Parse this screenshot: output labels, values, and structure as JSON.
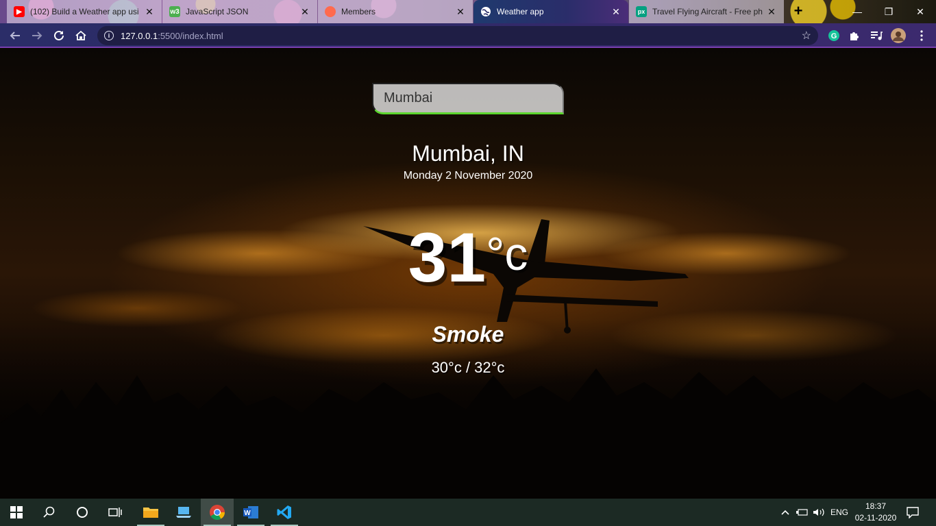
{
  "browser": {
    "tabs": [
      {
        "title": "(102) Build a Weather app usi",
        "favicon": "youtube-icon",
        "color": "#ff0000",
        "active": false
      },
      {
        "title": "JavaScript JSON",
        "favicon": "w3schools-icon",
        "color": "#4caf50",
        "active": false
      },
      {
        "title": "Members",
        "favicon": "members-icon",
        "color": "#ff6a4d",
        "active": false
      },
      {
        "title": "Weather app",
        "favicon": "globe-icon",
        "color": "#ffffff",
        "active": true
      },
      {
        "title": "Travel Flying Aircraft - Free ph",
        "favicon": "pexels-icon",
        "color": "#05a081",
        "active": false
      }
    ],
    "url_host": "127.0.0.1",
    "url_rest": ":5500/index.html"
  },
  "weather": {
    "search_value": "Mumbai",
    "location": "Mumbai, IN",
    "date": "Monday 2 November 2020",
    "temp": "31",
    "temp_unit": "°c",
    "condition": "Smoke",
    "hi_low": "30°c / 32°c"
  },
  "taskbar": {
    "language": "ENG",
    "time": "18:37",
    "date": "02-11-2020"
  },
  "colors": {
    "accent_green": "#5cd62e",
    "taskbar_bg": "#1c2a24"
  }
}
